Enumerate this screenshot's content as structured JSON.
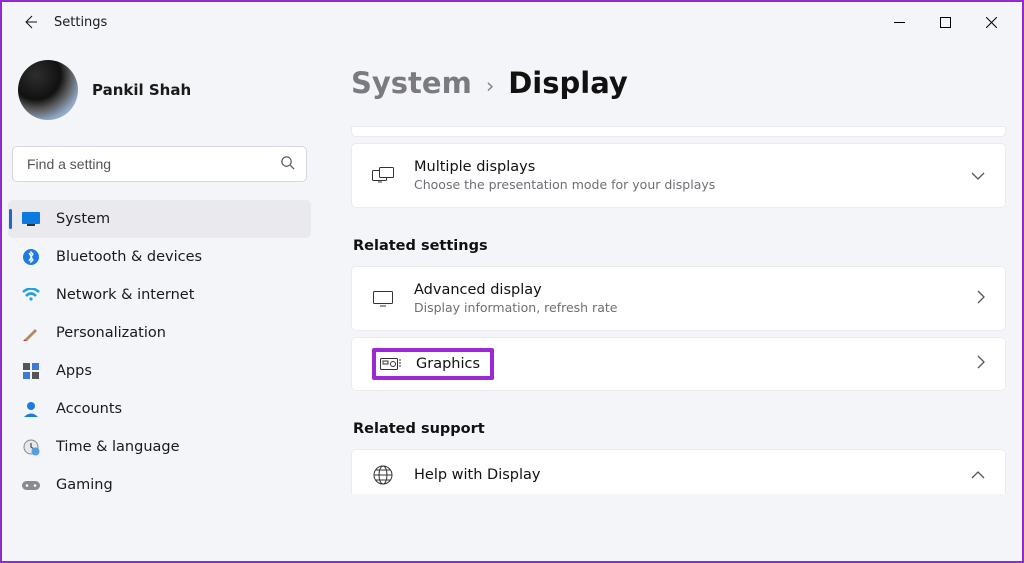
{
  "window": {
    "title": "Settings"
  },
  "profile": {
    "name": "Pankil Shah"
  },
  "search": {
    "placeholder": "Find a setting"
  },
  "sidebar": {
    "items": [
      {
        "label": "System"
      },
      {
        "label": "Bluetooth & devices"
      },
      {
        "label": "Network & internet"
      },
      {
        "label": "Personalization"
      },
      {
        "label": "Apps"
      },
      {
        "label": "Accounts"
      },
      {
        "label": "Time & language"
      },
      {
        "label": "Gaming"
      }
    ]
  },
  "breadcrumb": {
    "parent": "System",
    "current": "Display"
  },
  "cards": {
    "multiple_displays": {
      "title": "Multiple displays",
      "sub": "Choose the presentation mode for your displays"
    },
    "advanced_display": {
      "title": "Advanced display",
      "sub": "Display information, refresh rate"
    },
    "graphics": {
      "title": "Graphics"
    },
    "help_display": {
      "title": "Help with Display"
    }
  },
  "sections": {
    "related_settings": "Related settings",
    "related_support": "Related support"
  }
}
